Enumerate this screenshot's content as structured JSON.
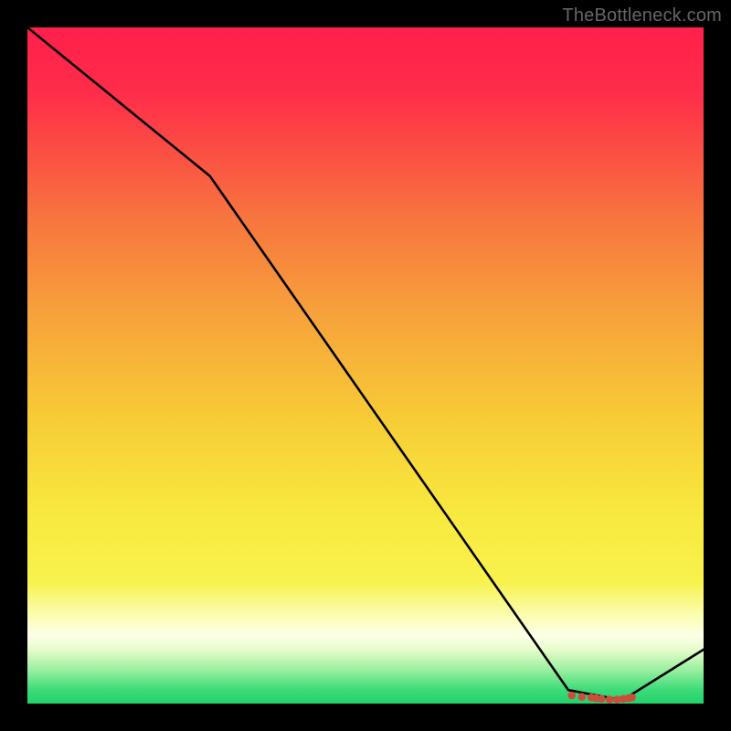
{
  "attribution": "TheBottleneck.com",
  "colors": {
    "black": "#000000",
    "gradient_top": "#FF1F4B",
    "gradient_upper_mid": "#F7A13C",
    "gradient_mid": "#F7D633",
    "gradient_lower_mid": "#F8F24D",
    "gradient_pale_band": "#FBFDB2",
    "gradient_bottom": "#23D16A",
    "curve": "#000000",
    "dots": "#CC4D3E"
  },
  "chart_data": {
    "type": "line",
    "title": "",
    "xlabel": "",
    "ylabel": "",
    "xlim": [
      0,
      100
    ],
    "ylim": [
      0,
      100
    ],
    "x": [
      0,
      27,
      80,
      88,
      100
    ],
    "values": [
      100,
      78,
      2,
      0.5,
      8
    ],
    "markers": {
      "x": [
        80.5,
        82,
        83.4,
        84.1,
        84.9,
        86.1,
        87.2,
        88.1,
        88.9,
        89.4
      ],
      "y": [
        1.2,
        1.0,
        0.9,
        0.8,
        0.7,
        0.6,
        0.6,
        0.7,
        0.8,
        0.9
      ]
    }
  }
}
